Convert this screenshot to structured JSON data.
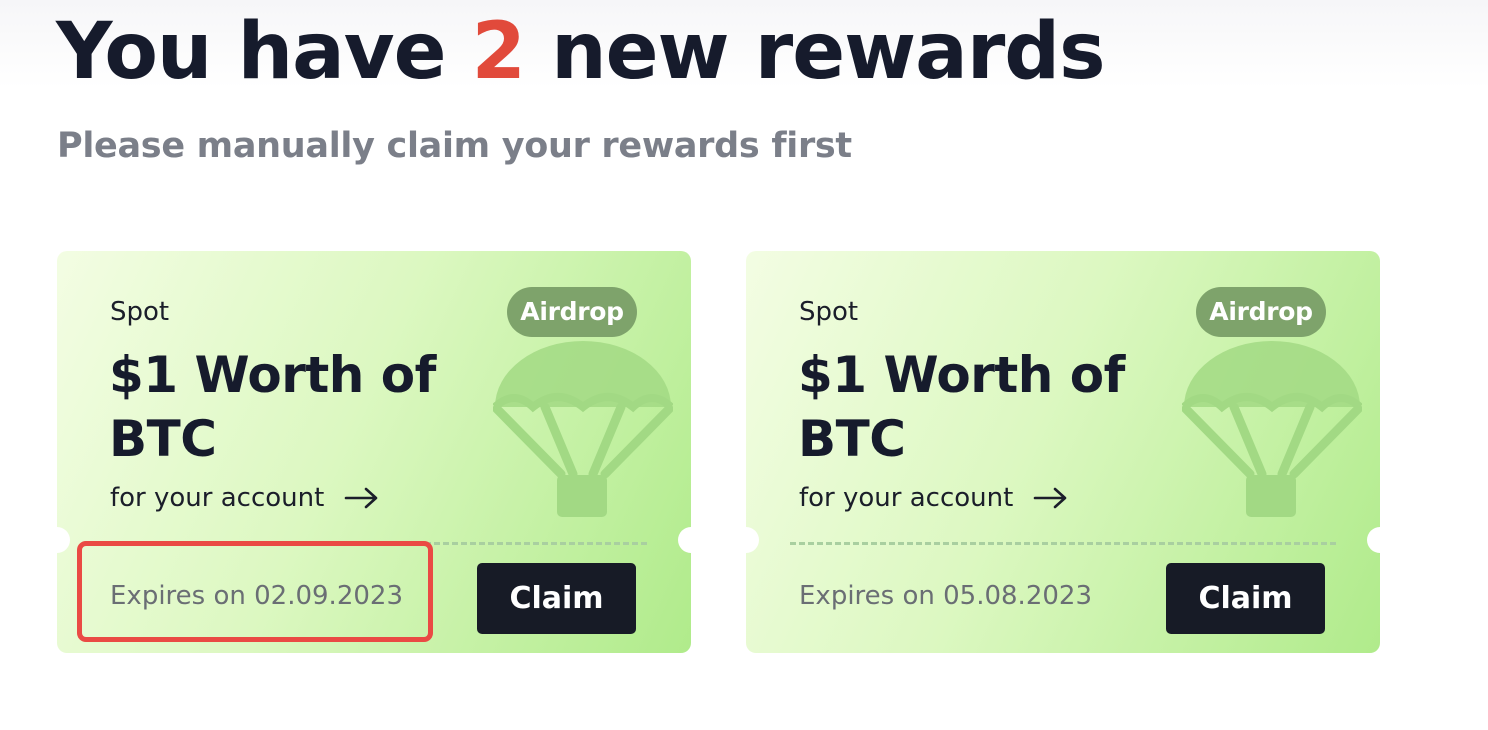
{
  "header": {
    "title_prefix": "You have",
    "reward_count": "2",
    "title_suffix": "new rewards",
    "subtitle": "Please manually claim your rewards first"
  },
  "rewards": [
    {
      "category": "Spot",
      "badge": "Airdrop",
      "title": "$1 Worth of BTC",
      "subtitle": "for your account",
      "expiry": "Expires on 02.09.2023",
      "claim_label": "Claim",
      "icon": "parachute-icon"
    },
    {
      "category": "Spot",
      "badge": "Airdrop",
      "title": "$1 Worth of BTC",
      "subtitle": "for your account",
      "expiry": "Expires on 05.08.2023",
      "claim_label": "Claim",
      "icon": "parachute-icon"
    }
  ],
  "colors": {
    "accent_count": "#e14a3b",
    "badge_bg": "#7ea36b",
    "claim_button_bg": "#171b26",
    "highlight_box": "#ea4a44"
  }
}
